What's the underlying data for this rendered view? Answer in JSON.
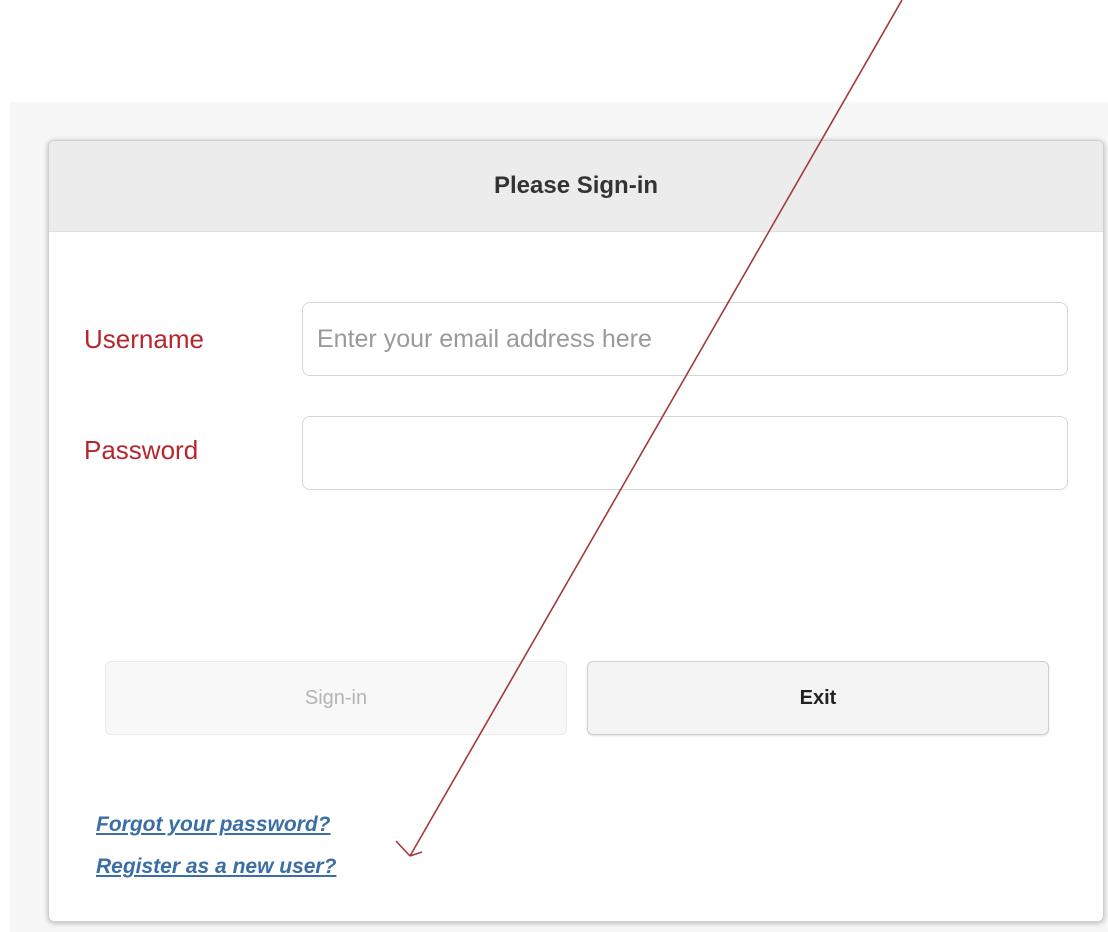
{
  "dialog": {
    "title": "Please Sign-in"
  },
  "form": {
    "username": {
      "label": "Username",
      "placeholder": "Enter your email address here",
      "value": ""
    },
    "password": {
      "label": "Password",
      "value": ""
    }
  },
  "buttons": {
    "signin_label": "Sign-in",
    "exit_label": "Exit"
  },
  "links": {
    "forgot_password": "Forgot your password?",
    "register": "Register as a new user?"
  },
  "colors": {
    "label": "#b5272d",
    "link": "#3a6ea5",
    "annotation_arrow": "#a33a3a"
  },
  "icons": {
    "annotation": "arrow-icon"
  }
}
